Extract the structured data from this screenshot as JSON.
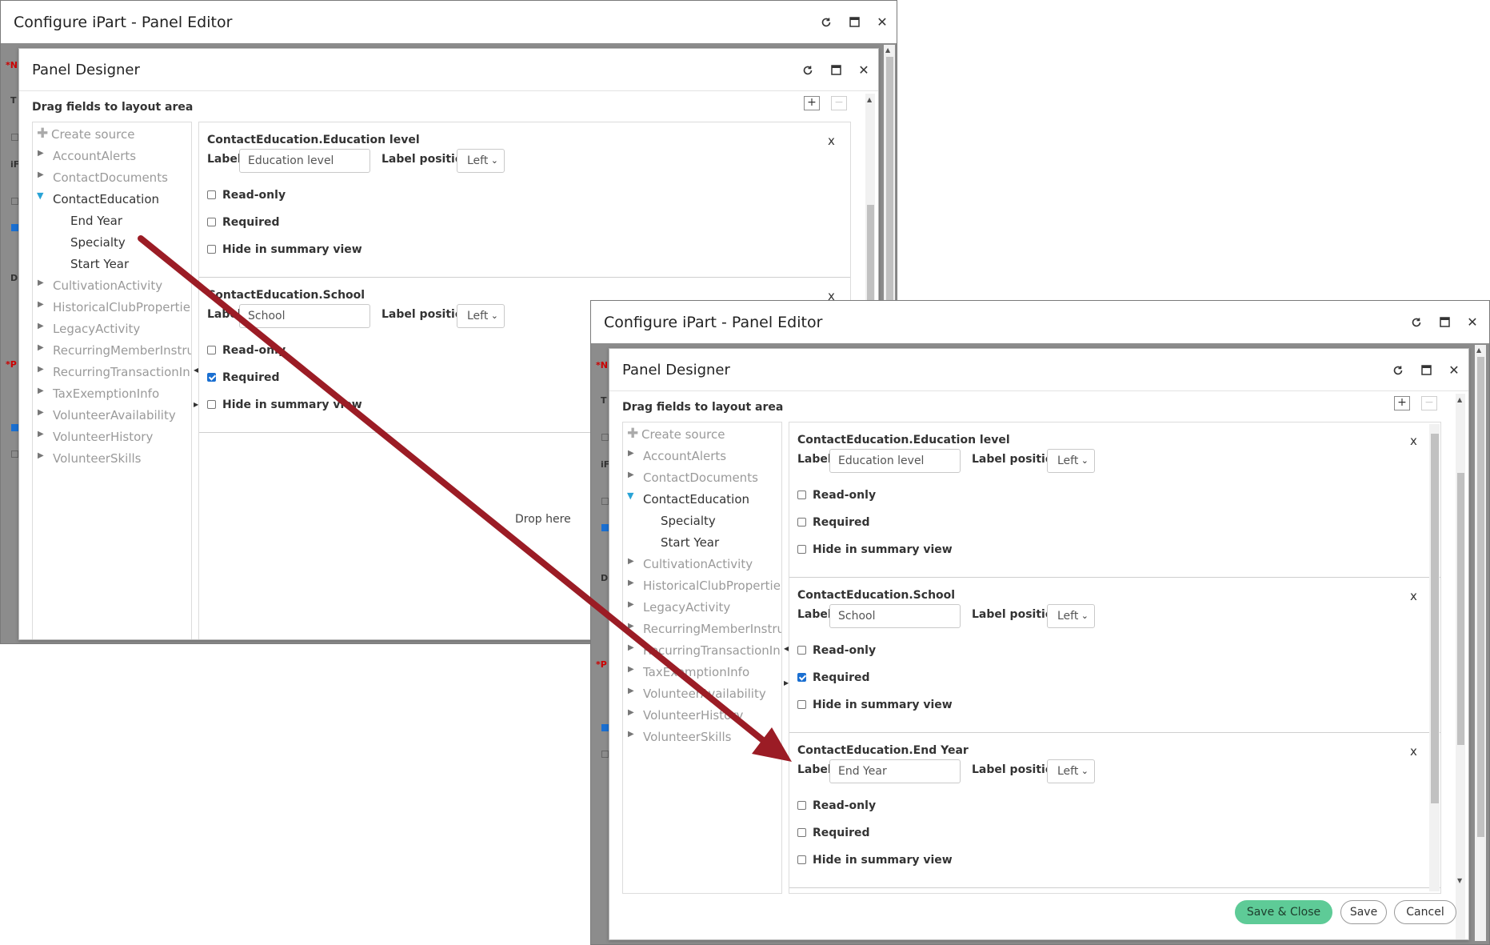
{
  "window_title": "Configure iPart - Panel Editor",
  "dialog_title": "Panel Designer",
  "drag_hint": "Drag fields to layout area",
  "add_label": "+",
  "remove_label": "−",
  "close_glyph": "✕",
  "tree_create_source": "Create source",
  "tree_before": [
    "AccountAlerts",
    "ContactDocuments"
  ],
  "tree_expanded": "ContactEducation",
  "tree_children_before": [
    "End Year",
    "Specialty",
    "Start Year"
  ],
  "tree_children_after": [
    "Specialty",
    "Start Year"
  ],
  "tree_after": [
    "CultivationActivity",
    "HistoricalClubPropertie",
    "LegacyActivity",
    "RecurringMemberInstru",
    "RecurringTransactionIn",
    "TaxExemptionInfo",
    "VolunteerAvailability",
    "VolunteerHistory",
    "VolunteerSkills"
  ],
  "field_labels": {
    "label": "Label",
    "label_position": "Label position",
    "read_only": "Read-only",
    "required": "Required",
    "hide_summary": "Hide in summary view",
    "remove_x": "x"
  },
  "cards": [
    {
      "title": "ContactEducation.Education level",
      "label_value": "Education level",
      "position": "Left",
      "read_only": false,
      "required": false,
      "hide_summary": false
    },
    {
      "title": "ContactEducation.School",
      "label_value": "School",
      "position": "Left",
      "read_only": false,
      "required": true,
      "hide_summary": false
    },
    {
      "title": "ContactEducation.End Year",
      "label_value": "End Year",
      "position": "Left",
      "read_only": false,
      "required": false,
      "hide_summary": false
    }
  ],
  "drop_here": "Drop here",
  "buttons": {
    "save_close": "Save & Close",
    "save": "Save",
    "cancel": "Cancel"
  },
  "colors": {
    "arrow": "#9b1c25",
    "primary_button": "#5ecb97",
    "expand_arrow": "#29a3d6",
    "checkbox_on": "#1a6fd1"
  },
  "icons": {
    "refresh": "refresh-icon",
    "maximize": "maximize-icon",
    "close": "close-icon",
    "expand": "triangle-right-icon",
    "collapse": "triangle-down-icon",
    "create": "plus-icon"
  }
}
